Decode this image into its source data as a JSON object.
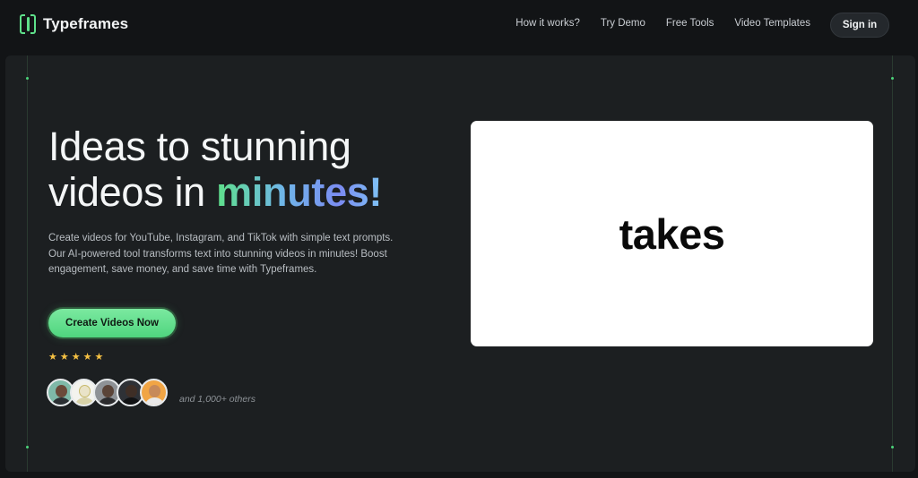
{
  "brand": {
    "name": "Typeframes",
    "accent": "#5ee08a"
  },
  "nav": {
    "links": [
      "How it works?",
      "Try Demo",
      "Free Tools",
      "Video Templates"
    ],
    "signin_label": "Sign in"
  },
  "hero": {
    "headline_part1": "Ideas to stunning",
    "headline_part2": "videos in ",
    "headline_highlight": "minutes!",
    "description": "Create videos for YouTube, Instagram, and TikTok with simple text prompts. Our AI-powered tool transforms text into stunning videos in minutes! Boost engagement, save money, and save time with Typeframes.",
    "cta_label": "Create Videos Now",
    "rating": {
      "stars": 5,
      "of": 5
    },
    "social_proof": "and 1,000+ others",
    "avatar_count": 5
  },
  "video_preview": {
    "caption_word": "takes"
  }
}
